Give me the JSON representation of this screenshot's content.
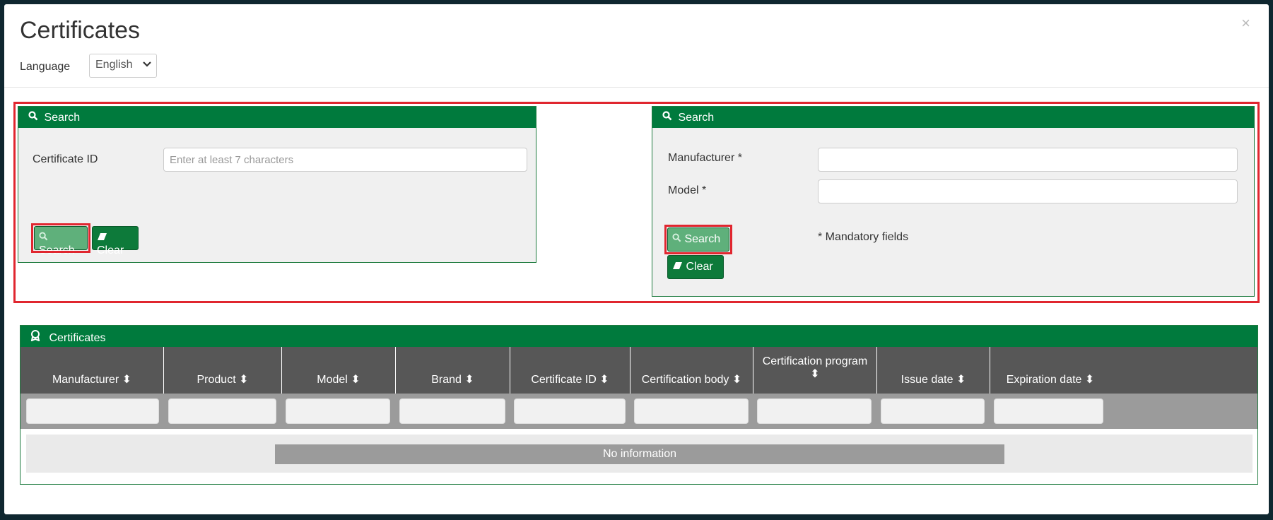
{
  "modal": {
    "title": "Certificates",
    "close_label": "×",
    "language_label": "Language",
    "language_value": "English"
  },
  "search_by_id": {
    "header": "Search",
    "certificate_id_label": "Certificate ID",
    "certificate_id_placeholder": "Enter at least 7 characters",
    "search_button": "Search",
    "clear_button": "Clear"
  },
  "search_by_model": {
    "header": "Search",
    "manufacturer_label": "Manufacturer *",
    "model_label": "Model *",
    "search_button": "Search",
    "clear_button": "Clear",
    "mandatory_note": "* Mandatory fields"
  },
  "certificates": {
    "header": "Certificates",
    "columns": [
      "Manufacturer",
      "Product",
      "Model",
      "Brand",
      "Certificate ID",
      "Certification body",
      "Certification program",
      "Issue date",
      "Expiration date"
    ],
    "sort_glyph": "⬍",
    "empty_message": "No information"
  },
  "colors": {
    "brand_green": "#007a3d",
    "highlight_red": "#e0262f",
    "header_gray": "#575757"
  },
  "icons": {
    "search": "magnifier-icon",
    "clear": "eraser-icon",
    "certificates": "award-ribbon-icon",
    "select": "chevron-down-icon",
    "sort": "sort-icon"
  }
}
